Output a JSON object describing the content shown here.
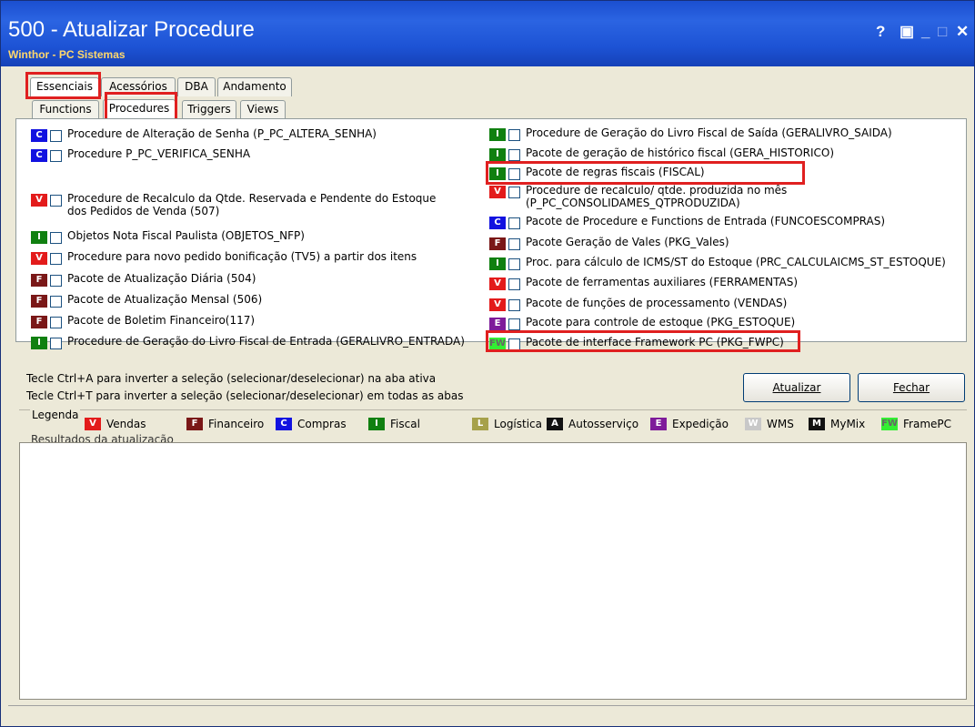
{
  "window": {
    "title": "500 - Atualizar Procedure",
    "subtitle": "Winthor - PC Sistemas",
    "help_label": "?",
    "minimize_label": "_",
    "maximize_label": "□",
    "close_label": "✕"
  },
  "tabs": [
    "Essenciais",
    "Acessórios",
    "DBA",
    "Andamento"
  ],
  "subtabs": [
    "Functions",
    "Procedures",
    "Triggers",
    "Views"
  ],
  "colors": {
    "V": "#e31b1b",
    "F": "#7a1717",
    "C": "#1212e0",
    "I": "#108010",
    "L": "#a6a14a",
    "A": "#111111",
    "E": "#7e1b9a",
    "W": "#c8c8c8",
    "M": "#111111",
    "FW": "#33ee33"
  },
  "left_items": [
    {
      "badge": "C",
      "label": "Procedure de Alteração de Senha (P_PC_ALTERA_SENHA)"
    },
    {
      "badge": "C",
      "label": "Procedure P_PC_VERIFICA_SENHA"
    },
    {
      "badge": "V",
      "label": "Procedure de Recalculo da Qtde. Reservada e Pendente do Estoque dos Pedidos de Venda (507)"
    },
    {
      "badge": "I",
      "label": "Objetos Nota Fiscal Paulista (OBJETOS_NFP)"
    },
    {
      "badge": "V",
      "label": "Procedure para novo pedido bonificação (TV5) a partir dos itens"
    },
    {
      "badge": "F",
      "label": "Pacote de Atualização Diária (504)"
    },
    {
      "badge": "F",
      "label": "Pacote de Atualização Mensal (506)"
    },
    {
      "badge": "F",
      "label": "Pacote de Boletim Financeiro(117)"
    },
    {
      "badge": "I",
      "label": "Procedure de Geração do Livro Fiscal de Entrada (GERALIVRO_ENTRADA)"
    }
  ],
  "right_items": [
    {
      "badge": "I",
      "label": "Procedure de Geração do Livro Fiscal de Saída (GERALIVRO_SAIDA)"
    },
    {
      "badge": "I",
      "label": "Pacote de geração de histórico fiscal (GERA_HISTORICO)"
    },
    {
      "badge": "I",
      "label": "Pacote de regras fiscais (FISCAL)"
    },
    {
      "badge": "V",
      "label": "Procedure de recalculo/ qtde. produzida no mês (P_PC_CONSOLIDAMES_QTPRODUZIDA)"
    },
    {
      "badge": "C",
      "label": "Pacote de Procedure e Functions de Entrada (FUNCOESCOMPRAS)"
    },
    {
      "badge": "F",
      "label": "Pacote Geração de Vales (PKG_Vales)"
    },
    {
      "badge": "I",
      "label": "Proc. para cálculo de ICMS/ST do Estoque (PRC_CALCULAICMS_ST_ESTOQUE)"
    },
    {
      "badge": "V",
      "label": "Pacote de ferramentas auxiliares (FERRAMENTAS)"
    },
    {
      "badge": "V",
      "label": "Pacote de funções de processamento (VENDAS)"
    },
    {
      "badge": "E",
      "label": "Pacote para controle de estoque (PKG_ESTOQUE)"
    },
    {
      "badge": "FW",
      "label": "Pacote de interface Framework PC (PKG_FWPC)"
    }
  ],
  "hints": [
    "Tecle Ctrl+A para inverter a seleção (selecionar/deselecionar) na aba ativa",
    "Tecle Ctrl+T para inverter a seleção (selecionar/deselecionar) em todas as abas"
  ],
  "buttons": {
    "update": "Atualizar",
    "close": "Fechar"
  },
  "legend_title": "Legenda",
  "legend": [
    {
      "badge": "V",
      "label": "Vendas"
    },
    {
      "badge": "F",
      "label": "Financeiro"
    },
    {
      "badge": "C",
      "label": "Compras"
    },
    {
      "badge": "I",
      "label": "Fiscal"
    },
    {
      "badge": "L",
      "label": "Logística"
    },
    {
      "badge": "A",
      "label": "Autosserviço"
    },
    {
      "badge": "E",
      "label": "Expedição"
    },
    {
      "badge": "W",
      "label": "WMS"
    },
    {
      "badge": "M",
      "label": "MyMix"
    },
    {
      "badge": "FW",
      "label": "FramePC"
    }
  ],
  "results_title": "Resultados da atualização"
}
